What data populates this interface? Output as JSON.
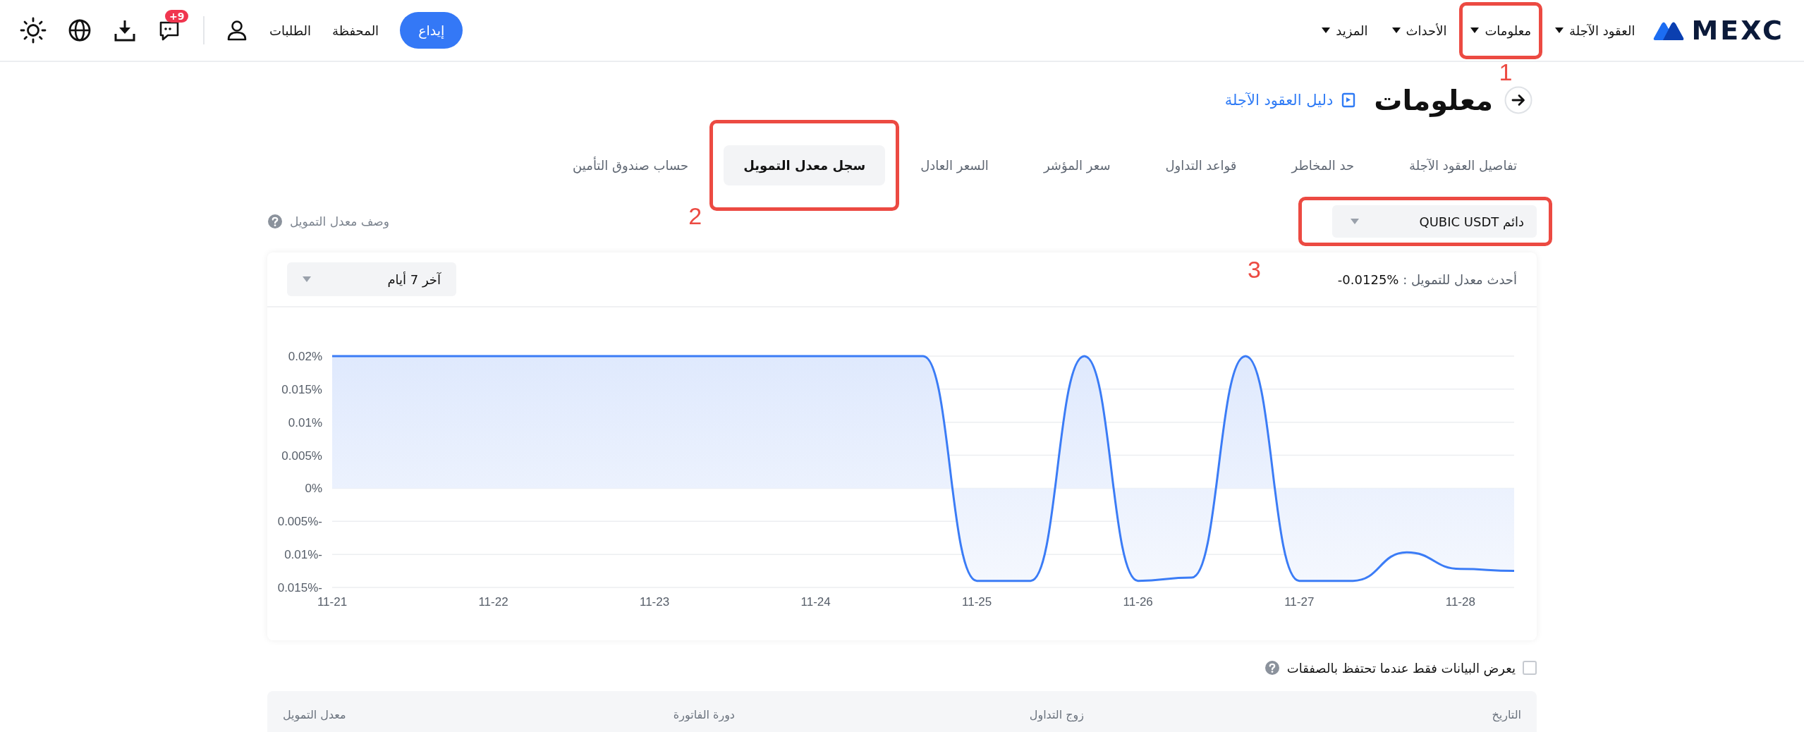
{
  "header": {
    "logo": "MEXC",
    "nav": [
      {
        "label": "العقود الآجلة"
      },
      {
        "label": "معلومات",
        "callout": "1"
      },
      {
        "label": "الأحداث"
      },
      {
        "label": "المزيد"
      }
    ],
    "deposit": "إيداع",
    "links": [
      "المحفظة",
      "الطلبات"
    ],
    "badge": "+9"
  },
  "page": {
    "title": "معلومات",
    "guide_link": "دليل العقود الآجلة"
  },
  "tabs": [
    {
      "label": "تفاصيل العقود الآجلة",
      "selected": false
    },
    {
      "label": "حد المخاطر",
      "selected": false
    },
    {
      "label": "قواعد التداول",
      "selected": false
    },
    {
      "label": "سعر المؤشر",
      "selected": false
    },
    {
      "label": "السعر العادل",
      "selected": false
    },
    {
      "label": "سجل معدل التمويل",
      "selected": true,
      "callout": "2"
    },
    {
      "label": "حساب صندوق التأمين",
      "selected": false
    }
  ],
  "symbol_select": {
    "value": "دائم QUBIC USDT",
    "callout": "3"
  },
  "funding_description": "وصف معدل التمويل",
  "chart_card": {
    "latest_label": "أحدث معدل للتمويل :",
    "latest_value": "-0.0125%",
    "period": "آخر 7 أيام",
    "chart_data": {
      "type": "area",
      "categories": [
        "11-21",
        null,
        null,
        "11-22",
        null,
        null,
        "11-23",
        null,
        null,
        "11-24",
        null,
        null,
        "11-25",
        null,
        null,
        "11-26",
        null,
        null,
        "11-27",
        null,
        null,
        "11-28",
        null
      ],
      "series": [
        {
          "color": "#3b7cf6",
          "values": [
            0.02,
            0.02,
            0.02,
            0.02,
            0.02,
            0.02,
            0.02,
            0.02,
            0.02,
            0.02,
            0.02,
            0.02,
            -0.014,
            -0.014,
            0.02,
            -0.014,
            -0.0135,
            0.02,
            -0.014,
            -0.014,
            -0.0097,
            -0.0122,
            -0.0125
          ]
        }
      ],
      "ylim": [
        -0.015,
        0.02
      ],
      "grid": true,
      "yticks": [
        {
          "value": 0.02,
          "label": "0.02%"
        },
        {
          "value": 0.015,
          "label": "0.015%"
        },
        {
          "value": 0.01,
          "label": "0.01%"
        },
        {
          "value": 0.005,
          "label": "0.005%"
        },
        {
          "value": 0,
          "label": "0%"
        },
        {
          "value": -0.005,
          "label": "0.005%-"
        },
        {
          "value": -0.01,
          "label": "0.01%-"
        },
        {
          "value": -0.015,
          "label": "0.015%-"
        }
      ]
    }
  },
  "holdings_filter": {
    "label": "يعرض البيانات فقط عندما تحتفظ بالصفقات",
    "checked": false
  },
  "table": {
    "columns": [
      "التاريخ",
      "زوج التداول",
      "دورة الفاتورة",
      "معدل التمويل"
    ]
  }
}
